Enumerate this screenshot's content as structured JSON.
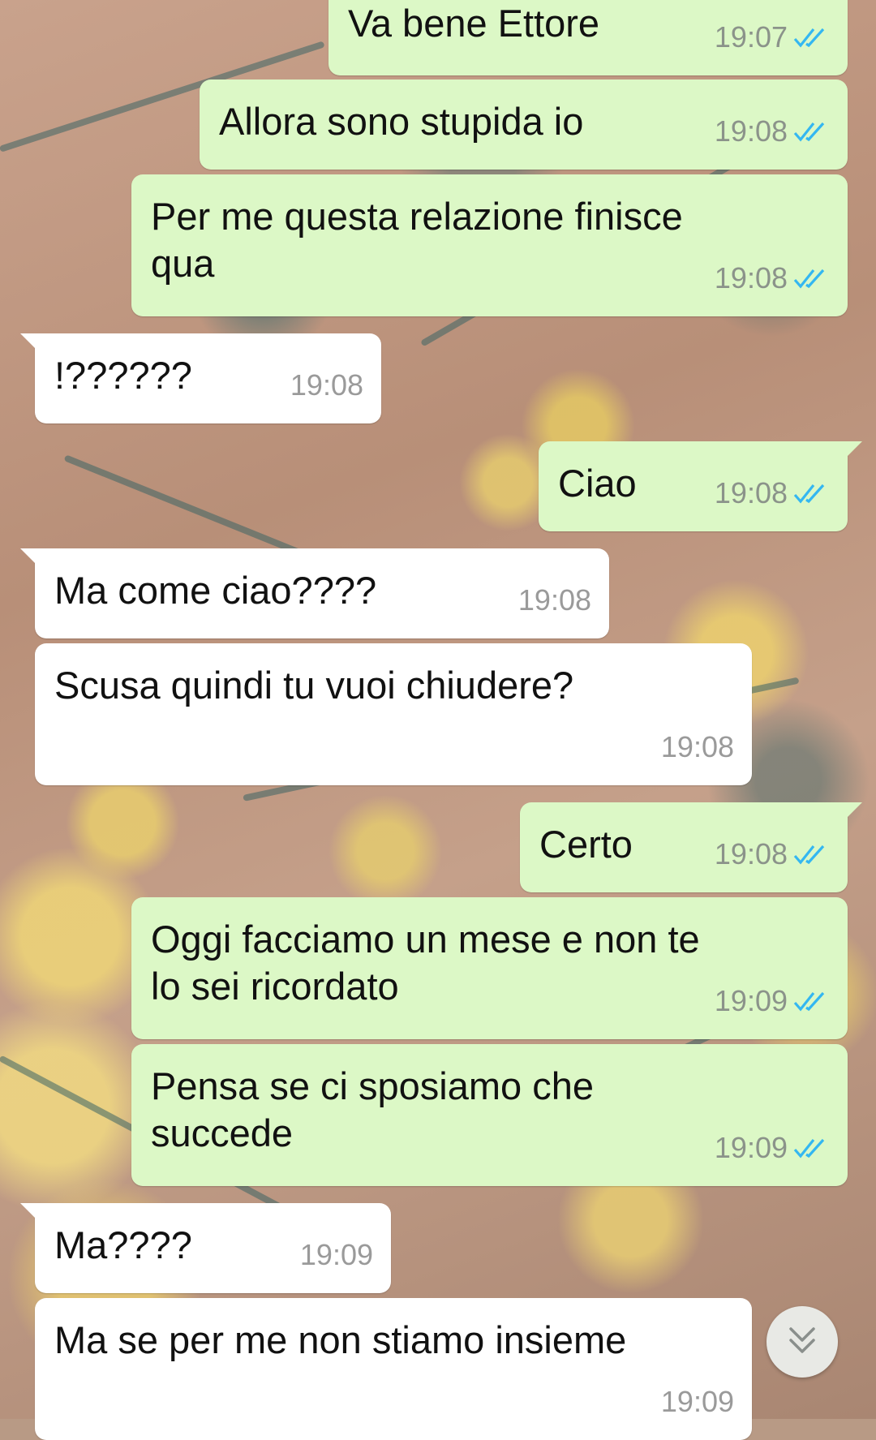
{
  "colors": {
    "outgoing_bubble": "#dcf8c6",
    "incoming_bubble": "#ffffff",
    "read_ticks": "#34b7f1",
    "timestamp": "#8b938a"
  },
  "messages": [
    {
      "direction": "out",
      "lines": [
        "Va bene Ettore"
      ],
      "time": "19:07",
      "status": "read"
    },
    {
      "direction": "out",
      "lines": [
        "Allora sono stupida io"
      ],
      "time": "19:08",
      "status": "read"
    },
    {
      "direction": "out",
      "lines": [
        "Per me questa relazione finisce",
        "qua"
      ],
      "time": "19:08",
      "status": "read"
    },
    {
      "direction": "in",
      "lines": [
        "!??????"
      ],
      "time": "19:08"
    },
    {
      "direction": "out",
      "lines": [
        "Ciao"
      ],
      "time": "19:08",
      "status": "read"
    },
    {
      "direction": "in",
      "lines": [
        "Ma come ciao????"
      ],
      "time": "19:08"
    },
    {
      "direction": "in",
      "lines": [
        "Scusa quindi tu vuoi chiudere?"
      ],
      "time": "19:08"
    },
    {
      "direction": "out",
      "lines": [
        "Certo"
      ],
      "time": "19:08",
      "status": "read"
    },
    {
      "direction": "out",
      "lines": [
        "Oggi facciamo un mese e non te",
        "lo sei ricordato"
      ],
      "time": "19:09",
      "status": "read"
    },
    {
      "direction": "out",
      "lines": [
        "Pensa se ci sposiamo che",
        "succede"
      ],
      "time": "19:09",
      "status": "read"
    },
    {
      "direction": "in",
      "lines": [
        "Ma????"
      ],
      "time": "19:09"
    },
    {
      "direction": "in",
      "lines": [
        "Ma se per me non stiamo insieme"
      ],
      "time": "19:09"
    }
  ],
  "icons": {
    "read_receipt": "double-check-icon",
    "scroll_down": "double-chevron-down-icon"
  }
}
